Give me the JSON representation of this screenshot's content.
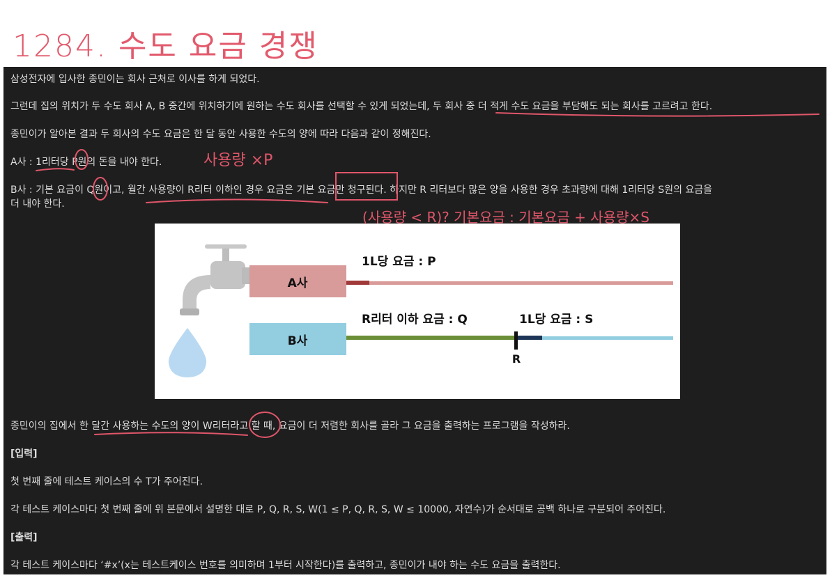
{
  "handwritten": {
    "title": "1284. 수도 요금 경쟁",
    "note_a": "사용량 ×P",
    "note_b": "(사용량 < R)? 기본요금 : 기본요금 + 사용량×S"
  },
  "problem": {
    "p1": "삼성전자에 입사한 종민이는 회사 근처로 이사를 하게 되었다.",
    "p2": "그런데 집의 위치가 두 수도 회사 A, B 중간에 위치하기에 원하는 수도 회사를 선택할 수 있게 되었는데, 두 회사 중 더 적게 수도 요금을 부담해도 되는 회사를 고르려고 한다.",
    "p3": "종민이가 알아본 결과 두 회사의 수도 요금은 한 달 동안 사용한 수도의 양에 따라 다음과 같이 정해진다.",
    "p4": "A사 : 1리터당 P원의 돈을 내야 한다.",
    "p5a": "B사 : 기본 요금이 Q원이고, 월간 사용량이 R리터 이하인 경우 요금은 기본 요금만 청구된다. 하지만 R 리터보다 많은 양을 사용한 경우 초과량에 대해 1리터당 S원의 요금을",
    "p5b": "더 내야 한다.",
    "p6": "종민이의 집에서 한 달간 사용하는 수도의 양이 W리터라고 할 때, 요금이 더 저렴한 회사를 골라 그 요금을 출력하는 프로그램을 작성하라.",
    "input_header": "[입력]",
    "input1": "첫 번째 줄에 테스트 케이스의 수 T가 주어진다.",
    "input2": "각 테스트 케이스마다 첫 번째 줄에 위 본문에서 설명한 대로 P, Q, R, S, W(1 ≤ P, Q, R, S, W ≤ 10000, 자연수)가 순서대로 공백 하나로 구분되어 주어진다.",
    "output_header": "[출력]",
    "output1": "각 테스트 케이스마다 ‘#x’(x는 테스트케이스 번호를 의미하며 1부터 시작한다)를 출력하고, 종민이가 내야 하는 수도 요금을 출력한다."
  },
  "figure": {
    "company_a": "A사",
    "company_b": "B사",
    "a_rate": "1L당 요금 : P",
    "b_base": "R리터 이하 요금 : Q",
    "b_rate": "1L당 요금 : S",
    "r_mark": "R"
  },
  "colors": {
    "panel": "#1e1e1e",
    "text": "#dcdcdc",
    "ink": "#e0566a",
    "a_box": "#d99a9a",
    "b_box": "#92cde0"
  }
}
